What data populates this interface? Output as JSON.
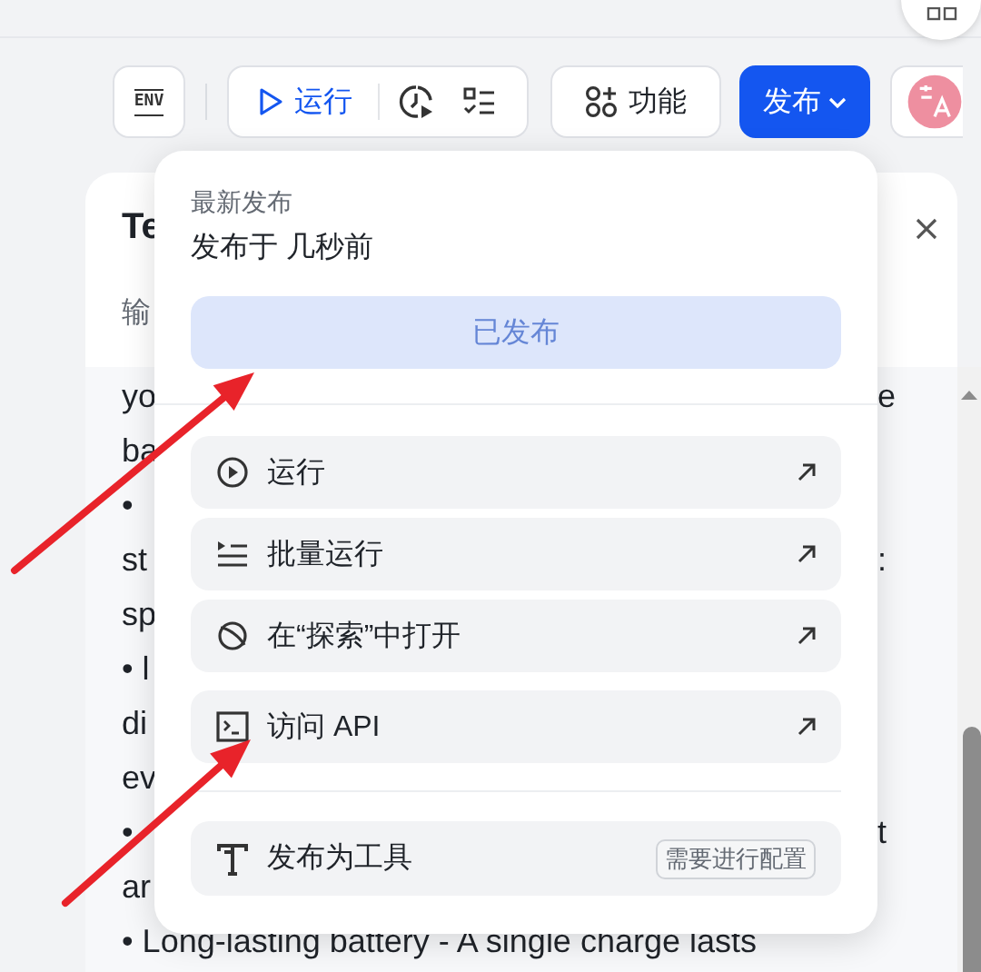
{
  "toolbar": {
    "env_button": "ENV",
    "run_button": "运行",
    "features_button": "功能",
    "publish_button": "发布"
  },
  "panel": {
    "title": "Te",
    "input_label": "输",
    "rows": [
      {
        "left": "yo",
        "right": "e"
      },
      {
        "left": "ba"
      },
      {
        "left": "•"
      },
      {
        "left": "st",
        "right": ":"
      },
      {
        "left": "sp"
      },
      {
        "left": "• l"
      },
      {
        "left": "di"
      },
      {
        "left": "ev"
      },
      {
        "left": "•",
        "right": "t"
      },
      {
        "left": "ar"
      },
      {
        "left": "• Long-lasting battery - A single charge lasts"
      }
    ]
  },
  "publish_menu": {
    "heading": "最新发布",
    "published_at": "发布于 几秒前",
    "status_button": {
      "label": "已发布",
      "disabled": true
    },
    "actions": [
      {
        "kind": "run",
        "label": "运行"
      },
      {
        "kind": "batch",
        "label": "批量运行"
      },
      {
        "kind": "explore",
        "label": "在“探索”中打开"
      },
      {
        "kind": "api",
        "label": "访问 API"
      }
    ],
    "tool_item": {
      "label": "发布为工具",
      "badge": "需要进行配置"
    }
  }
}
